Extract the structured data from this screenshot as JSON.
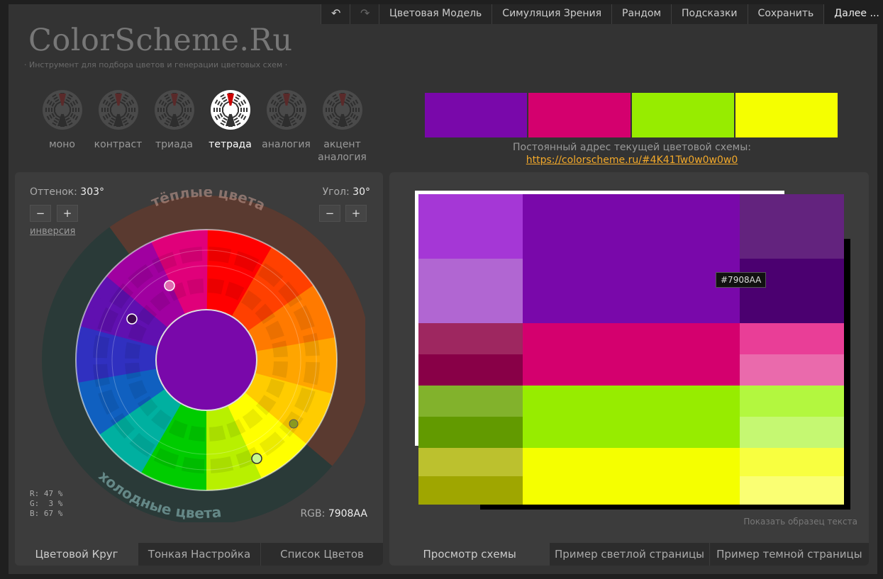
{
  "toolbar": {
    "undo_icon": "↶",
    "redo_icon": "↷",
    "items": [
      "Цветовая Модель",
      "Симуляция Зрения",
      "Рандом",
      "Подсказки",
      "Сохранить"
    ],
    "more": "Далее ..."
  },
  "header": {
    "logo": "ColorScheme.Ru",
    "tagline": "· Инструмент для подбора цветов и генерации цветовых схем ·"
  },
  "schemes": [
    {
      "label": "моно",
      "active": false
    },
    {
      "label": "контраст",
      "active": false
    },
    {
      "label": "триада",
      "active": false
    },
    {
      "label": "тетрада",
      "active": true
    },
    {
      "label": "аналогия",
      "active": false
    },
    {
      "label": "акцент аналогия",
      "active": false
    }
  ],
  "swatches": [
    "#7908AA",
    "#D4006E",
    "#97EC00",
    "#F5FF00"
  ],
  "permalink": {
    "label": "Постоянный адрес текущей цветовой схемы:",
    "url": "https://colorscheme.ru/#4K41Tw0w0w0w0"
  },
  "wheel_panel": {
    "hue_label": "Оттенок:",
    "hue_value": "303°",
    "angle_label": "Угол:",
    "angle_value": "30°",
    "minus": "−",
    "plus": "+",
    "inversion": "инверсия",
    "warm_label": "тёплые цвета",
    "cold_label": "холодные цвета",
    "rgb_percent": "R: 47 %\nG:  3 %\nB: 67 %",
    "rgb_label": "RGB:",
    "rgb_value": "7908AA",
    "center_color": "#7908AA",
    "tabs": [
      "Цветовой Круг",
      "Тонкая Настройка",
      "Список Цветов"
    ]
  },
  "preview_panel": {
    "tooltip": "#7908AA",
    "show_sample": "Показать образец текста",
    "tabs": [
      "Просмотр схемы",
      "Пример светлой страницы",
      "Пример темной страницы"
    ],
    "palette": {
      "purple": {
        "main": "#7908AA",
        "left": [
          "#A537D6",
          "#B166D2"
        ],
        "right": [
          "#63237E",
          "#4B0070"
        ]
      },
      "magenta": {
        "main": "#D4006E",
        "left": [
          "#9E2760",
          "#880047"
        ],
        "right": [
          "#E93E97",
          "#EA6AAC"
        ]
      },
      "green": {
        "main": "#97EC00",
        "left": [
          "#82B22C",
          "#629A00"
        ],
        "right": [
          "#B3F73F",
          "#C5F872"
        ]
      },
      "yellow": {
        "main": "#F5FF00",
        "left": [
          "#BCC12E",
          "#9FA600"
        ],
        "right": [
          "#F8FF40",
          "#FAFF73"
        ]
      }
    }
  }
}
